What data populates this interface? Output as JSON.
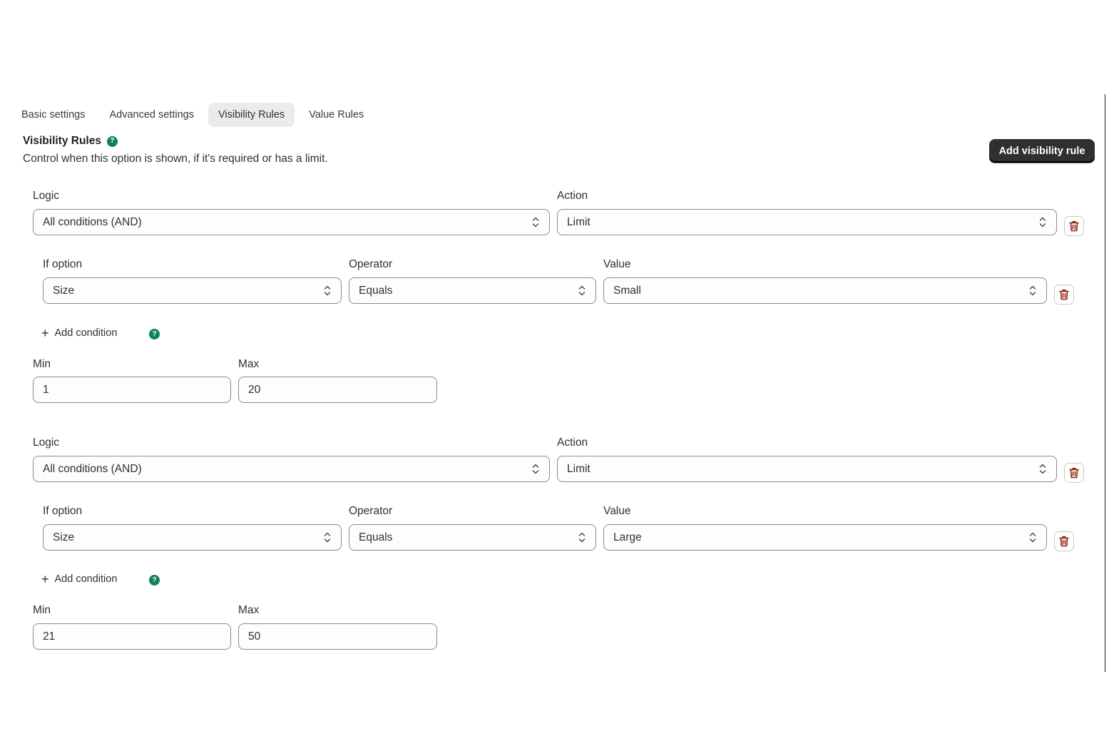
{
  "tabs": [
    {
      "label": "Basic settings",
      "active": false
    },
    {
      "label": "Advanced settings",
      "active": false
    },
    {
      "label": "Visibility Rules",
      "active": true
    },
    {
      "label": "Value Rules",
      "active": false
    }
  ],
  "section": {
    "title": "Visibility Rules",
    "description": "Control when this option is shown, if it's required or has a limit.",
    "add_rule_label": "Add visibility rule"
  },
  "labels": {
    "logic": "Logic",
    "action": "Action",
    "if_option": "If option",
    "operator": "Operator",
    "value": "Value",
    "add_condition": "Add condition",
    "min": "Min",
    "max": "Max"
  },
  "rules": [
    {
      "logic": "All conditions (AND)",
      "action": "Limit",
      "condition": {
        "option": "Size",
        "operator": "Equals",
        "value": "Small"
      },
      "min": "1",
      "max": "20"
    },
    {
      "logic": "All conditions (AND)",
      "action": "Limit",
      "condition": {
        "option": "Size",
        "operator": "Equals",
        "value": "Large"
      },
      "min": "21",
      "max": "50"
    }
  ],
  "colors": {
    "help_icon": "#0e7f5f",
    "trash_icon": "#8e1f0b",
    "primary_button": "#303030"
  }
}
